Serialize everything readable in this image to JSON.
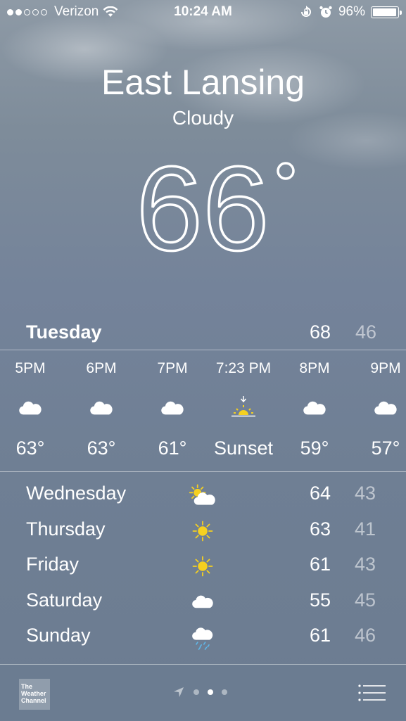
{
  "status_bar": {
    "carrier": "Verizon",
    "time": "10:24 AM",
    "battery": "96%",
    "battery_level": 0.96,
    "signal_dots_filled": 2,
    "signal_dots_total": 5
  },
  "location": {
    "city": "East Lansing",
    "condition": "Cloudy",
    "temperature": "66",
    "degree_symbol": "°"
  },
  "today": {
    "day": "Tuesday",
    "high": "68",
    "low": "46"
  },
  "hourly": [
    {
      "time": "5PM",
      "icon": "cloud-icon",
      "value": "63°"
    },
    {
      "time": "6PM",
      "icon": "cloud-icon",
      "value": "63°"
    },
    {
      "time": "7PM",
      "icon": "cloud-icon",
      "value": "61°"
    },
    {
      "time": "7:23 PM",
      "icon": "sunset-icon",
      "value": "Sunset"
    },
    {
      "time": "8PM",
      "icon": "cloud-icon",
      "value": "59°"
    },
    {
      "time": "9PM",
      "icon": "cloud-icon",
      "value": "57°"
    }
  ],
  "daily": [
    {
      "day": "Wednesday",
      "icon": "partly-cloudy-icon",
      "high": "64",
      "low": "43"
    },
    {
      "day": "Thursday",
      "icon": "sun-icon",
      "high": "63",
      "low": "41"
    },
    {
      "day": "Friday",
      "icon": "sun-icon",
      "high": "61",
      "low": "43"
    },
    {
      "day": "Saturday",
      "icon": "cloud-icon",
      "high": "55",
      "low": "45"
    },
    {
      "day": "Sunday",
      "icon": "rain-icon",
      "high": "61",
      "low": "46"
    }
  ],
  "bottom": {
    "logo_text": "The Weather Channel",
    "pages_total": 3,
    "page_active": 2
  },
  "colors": {
    "sun": "#f5d020",
    "rain": "#5fb7e8"
  }
}
